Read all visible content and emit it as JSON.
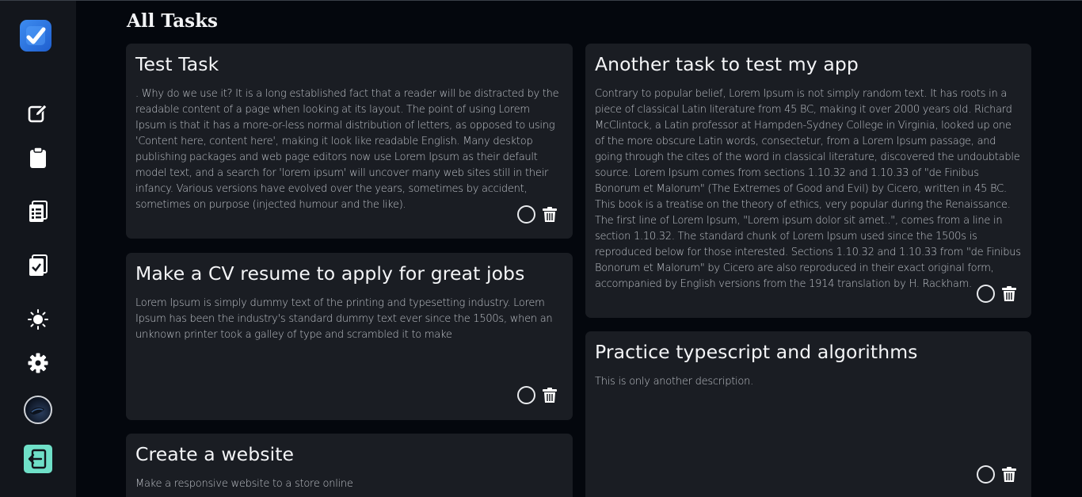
{
  "page": {
    "title": "All Tasks"
  },
  "sidebar": {
    "items": [
      {
        "icon": "edit-icon"
      },
      {
        "icon": "clipboard-icon"
      },
      {
        "icon": "clipboard-list-icon"
      },
      {
        "icon": "clipboard-check-icon"
      },
      {
        "icon": "sun-icon"
      },
      {
        "icon": "gear-icon"
      }
    ]
  },
  "tasks": [
    {
      "title": "Test Task",
      "description": ". Why do we use it? It is a long established fact that a reader will be distracted by the readable content of a page when looking at its layout. The point of using Lorem Ipsum is that it has a more-or-less normal distribution of letters, as opposed to using 'Content here, content here', making it look like readable English. Many desktop publishing packages and web page editors now use Lorem Ipsum as their default model text, and a search for 'lorem ipsum' will uncover many web sites still in their infancy. Various versions have evolved over the years, sometimes by accident, sometimes on purpose (injected humour and the like)."
    },
    {
      "title": "Another task to test my app",
      "description": "Contrary to popular belief, Lorem Ipsum is not simply random text. It has roots in a piece of classical Latin literature from 45 BC, making it over 2000 years old. Richard McClintock, a Latin professor at Hampden-Sydney College in Virginia, looked up one of the more obscure Latin words, consectetur, from a Lorem Ipsum passage, and going through the cites of the word in classical literature, discovered the undoubtable source. Lorem Ipsum comes from sections 1.10.32 and 1.10.33 of \"de Finibus Bonorum et Malorum\" (The Extremes of Good and Evil) by Cicero, written in 45 BC. This book is a treatise on the theory of ethics, very popular during the Renaissance. The first line of Lorem Ipsum, \"Lorem ipsum dolor sit amet..\", comes from a line in section 1.10.32. The standard chunk of Lorem Ipsum used since the 1500s is reproduced below for those interested. Sections 1.10.32 and 1.10.33 from \"de Finibus Bonorum et Malorum\" by Cicero are also reproduced in their exact original form, accompanied by English versions from the 1914 translation by H. Rackham."
    },
    {
      "title": "Make a CV resume to apply for great jobs",
      "description": "Lorem Ipsum is simply dummy text of the printing and typesetting industry. Lorem Ipsum has been the industry's standard dummy text ever since the 1500s, when an unknown printer took a galley of type and scrambled it to make"
    },
    {
      "title": "Practice typescript and algorithms",
      "description": "This is only another description."
    },
    {
      "title": "Create a website",
      "description": "Make a responsive website to a store online"
    }
  ],
  "colors": {
    "accent": "#3d8cf0",
    "logout": "#6fe0c8",
    "card": "#1a1d23",
    "background": "#04070d"
  }
}
